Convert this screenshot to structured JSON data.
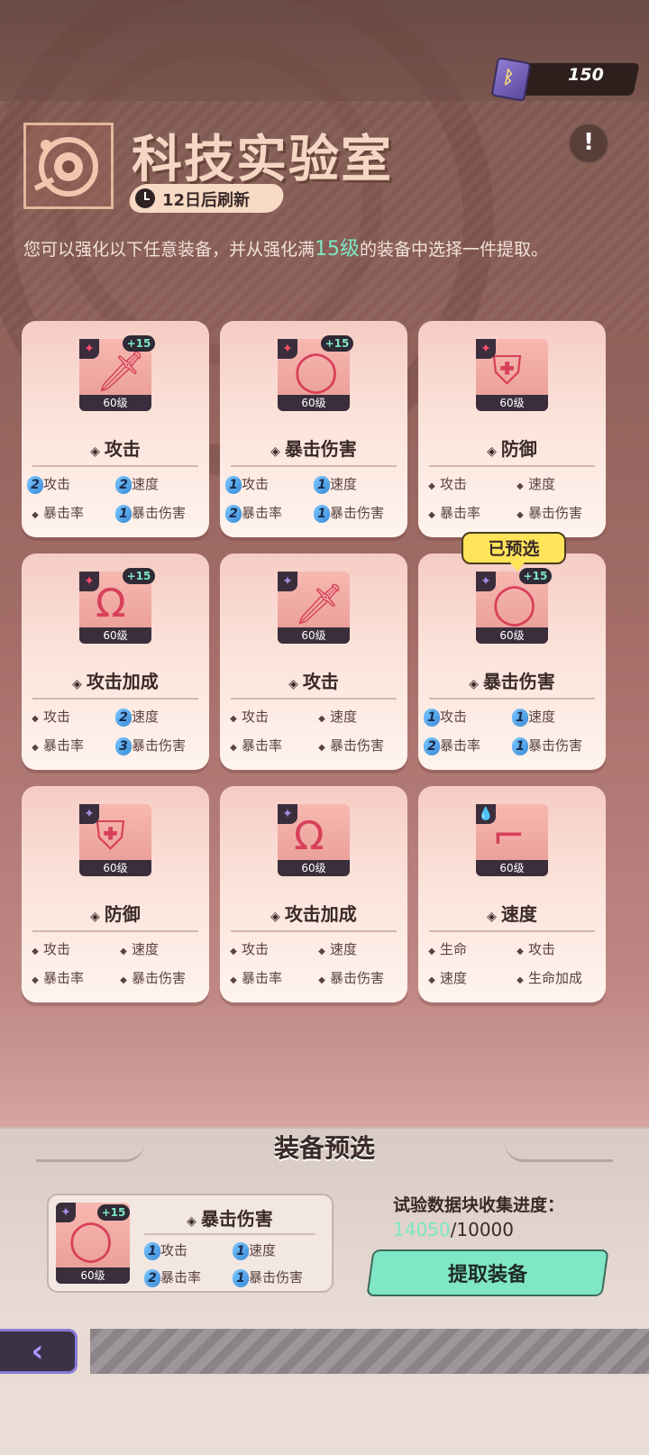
{
  "currency": {
    "icon": "book-token-icon",
    "amount": "150"
  },
  "header": {
    "title": "科技实验室",
    "refresh_label": "12日后刷新",
    "info_label": "!"
  },
  "description": {
    "before": "您可以强化以下任意装备，并从强化满",
    "highlight": "15级",
    "after": "的装备中选择一件提取。"
  },
  "cards": [
    {
      "main_stat": "攻击",
      "level": "60级",
      "plus": "+15",
      "item": "sword",
      "tab_color": "red",
      "subs": [
        {
          "label": "攻击",
          "count": "2"
        },
        {
          "label": "速度",
          "count": "2"
        },
        {
          "label": "暴击率",
          "count": ""
        },
        {
          "label": "暴击伤害",
          "count": "1"
        }
      ]
    },
    {
      "main_stat": "暴击伤害",
      "level": "60级",
      "plus": "+15",
      "item": "ring",
      "tab_color": "red",
      "subs": [
        {
          "label": "攻击",
          "count": "1"
        },
        {
          "label": "速度",
          "count": "1"
        },
        {
          "label": "暴击率",
          "count": "2"
        },
        {
          "label": "暴击伤害",
          "count": "1"
        }
      ]
    },
    {
      "main_stat": "防御",
      "level": "60级",
      "plus": "",
      "item": "armor",
      "tab_color": "red",
      "subs": [
        {
          "label": "攻击",
          "count": ""
        },
        {
          "label": "速度",
          "count": ""
        },
        {
          "label": "暴击率",
          "count": ""
        },
        {
          "label": "暴击伤害",
          "count": ""
        }
      ]
    },
    {
      "main_stat": "攻击加成",
      "level": "60级",
      "plus": "+15",
      "item": "headphones",
      "tab_color": "red",
      "subs": [
        {
          "label": "攻击",
          "count": ""
        },
        {
          "label": "速度",
          "count": "2"
        },
        {
          "label": "暴击率",
          "count": ""
        },
        {
          "label": "暴击伤害",
          "count": "3"
        }
      ]
    },
    {
      "main_stat": "攻击",
      "level": "60级",
      "plus": "",
      "item": "sword",
      "tab_color": "purple",
      "subs": [
        {
          "label": "攻击",
          "count": ""
        },
        {
          "label": "速度",
          "count": ""
        },
        {
          "label": "暴击率",
          "count": ""
        },
        {
          "label": "暴击伤害",
          "count": ""
        }
      ]
    },
    {
      "main_stat": "暴击伤害",
      "level": "60级",
      "plus": "+15",
      "item": "ring",
      "tab_color": "purple",
      "preselected": "已预选",
      "subs": [
        {
          "label": "攻击",
          "count": "1"
        },
        {
          "label": "速度",
          "count": "1"
        },
        {
          "label": "暴击率",
          "count": "2"
        },
        {
          "label": "暴击伤害",
          "count": "1"
        }
      ]
    },
    {
      "main_stat": "防御",
      "level": "60级",
      "plus": "",
      "item": "armor",
      "tab_color": "purple",
      "subs": [
        {
          "label": "攻击",
          "count": ""
        },
        {
          "label": "速度",
          "count": ""
        },
        {
          "label": "暴击率",
          "count": ""
        },
        {
          "label": "暴击伤害",
          "count": ""
        }
      ]
    },
    {
      "main_stat": "攻击加成",
      "level": "60级",
      "plus": "",
      "item": "headphones",
      "tab_color": "purple",
      "subs": [
        {
          "label": "攻击",
          "count": ""
        },
        {
          "label": "速度",
          "count": ""
        },
        {
          "label": "暴击率",
          "count": ""
        },
        {
          "label": "暴击伤害",
          "count": ""
        }
      ]
    },
    {
      "main_stat": "速度",
      "level": "60级",
      "plus": "",
      "item": "boot",
      "tab_color": "blue",
      "subs": [
        {
          "label": "生命",
          "count": ""
        },
        {
          "label": "攻击",
          "count": ""
        },
        {
          "label": "速度",
          "count": ""
        },
        {
          "label": "生命加成",
          "count": ""
        }
      ]
    }
  ],
  "preselect_panel": {
    "title": "装备预选",
    "item": {
      "main_stat": "暴击伤害",
      "level": "60级",
      "plus": "+15",
      "subs": [
        {
          "label": "攻击",
          "count": "1"
        },
        {
          "label": "速度",
          "count": "1"
        },
        {
          "label": "暴击率",
          "count": "2"
        },
        {
          "label": "暴击伤害",
          "count": "1"
        }
      ]
    },
    "progress_label": "试验数据块收集进度：",
    "progress_current": "14050",
    "progress_total": "/10000",
    "extract_label": "提取装备"
  },
  "nav": {
    "back_label": "‹"
  }
}
